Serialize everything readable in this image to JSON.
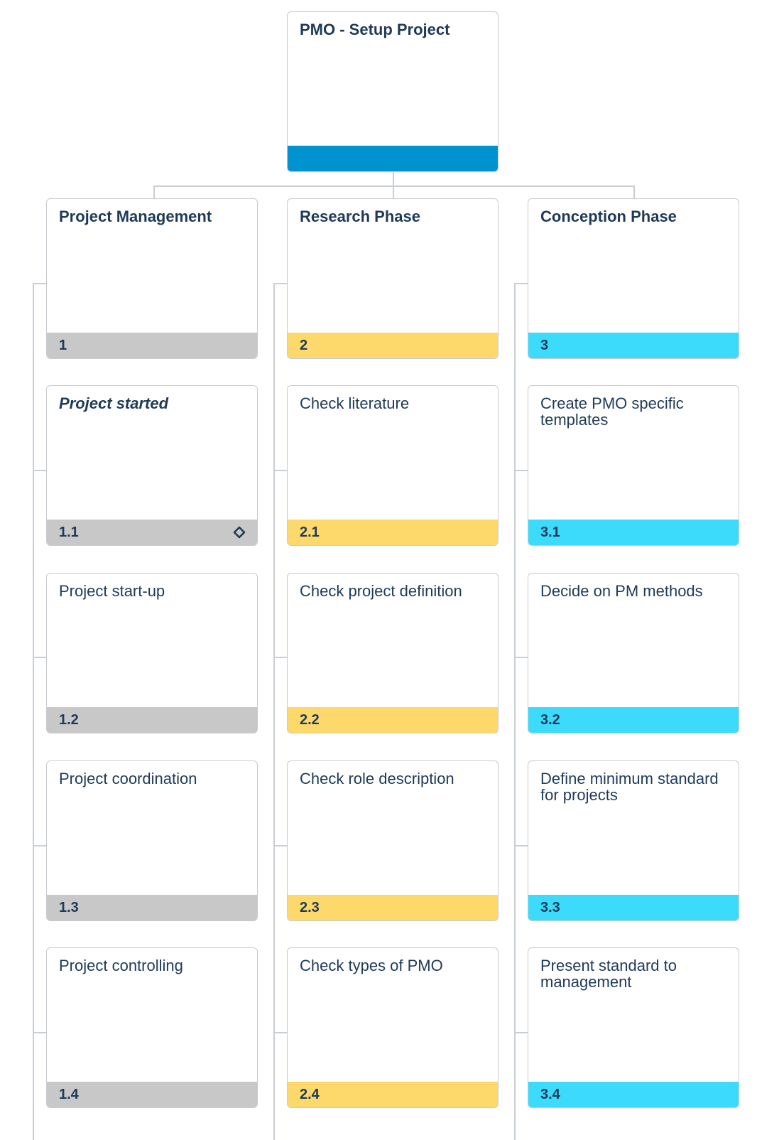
{
  "root": {
    "title": "PMO - Setup Project",
    "footer_color": "#0093d0"
  },
  "phases": [
    {
      "title": "Project Management",
      "number": "1",
      "color": "#c8c8c8",
      "tasks": [
        {
          "title": "Project started",
          "number": "1.1",
          "milestone": true
        },
        {
          "title": "Project start-up",
          "number": "1.2"
        },
        {
          "title": "Project coordination",
          "number": "1.3"
        },
        {
          "title": "Project controlling",
          "number": "1.4"
        }
      ]
    },
    {
      "title": "Research Phase",
      "number": "2",
      "color": "#fdd96c",
      "tasks": [
        {
          "title": "Check literature",
          "number": "2.1"
        },
        {
          "title": "Check project definition",
          "number": "2.2"
        },
        {
          "title": "Check role description",
          "number": "2.3"
        },
        {
          "title": "Check types of PMO",
          "number": "2.4"
        }
      ]
    },
    {
      "title": "Conception Phase",
      "number": "3",
      "color": "#3ddbfb",
      "tasks": [
        {
          "title": "Create PMO specific templates",
          "number": "3.1"
        },
        {
          "title": "Decide on PM methods",
          "number": "3.2"
        },
        {
          "title": "Define minimum standard for projects",
          "number": "3.3"
        },
        {
          "title": "Present standard to management",
          "number": "3.4"
        }
      ]
    }
  ],
  "icons": {
    "milestone": "diamond-milestone-icon"
  }
}
